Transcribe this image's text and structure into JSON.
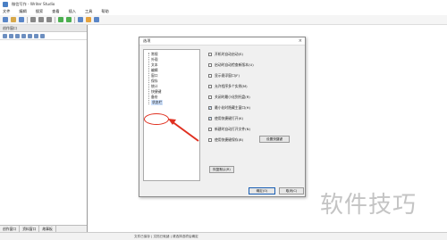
{
  "window": {
    "title": "微信写作 - Writer Studio"
  },
  "menubar": {
    "items": [
      "文件",
      "编辑",
      "搜索",
      "查看",
      "插入",
      "工具",
      "帮助"
    ]
  },
  "leftpanel": {
    "caption": "创作窗口",
    "tabs": [
      "创作窗口",
      "资料窗口",
      "故事板"
    ]
  },
  "status": {
    "text": "文件已保存 | 文档已就绪 | 请选择选项后确定"
  },
  "dialog": {
    "title": "选项",
    "close_glyph": "×",
    "tree": [
      "常规",
      "外观",
      "文本",
      "编辑",
      "窗口",
      "保存",
      "统计",
      "快捷键",
      "备份",
      "状态栏"
    ],
    "selected_index": 9,
    "options": [
      {
        "label": "开机时自动启动(S)",
        "checked": false
      },
      {
        "label": "启动时自动检查新版本(U)",
        "checked": false
      },
      {
        "label": "显示悬浮窗口(F)",
        "checked": false
      },
      {
        "label": "允许程序多个实例(M)",
        "checked": false
      },
      {
        "label": "关闭时最小化到托盘(R)",
        "checked": false
      },
      {
        "label": "最小化时隐藏主窗口(H)",
        "checked": true
      },
      {
        "label": "使用快捷键打开(K)",
        "checked": true
      },
      {
        "label": "新建时自动打开文件(N)",
        "checked": false
      },
      {
        "label": "使用快捷键保存(B)",
        "checked": false
      }
    ],
    "shortcut_button": "设置快捷键",
    "reset_button": "恢复默认(R)",
    "ok_button": "确定(O)",
    "cancel_button": "取消(C)"
  },
  "watermark": {
    "text": "软件技巧"
  },
  "colors": {
    "annotation": "#e03020",
    "selection": "#cfe3ff"
  }
}
